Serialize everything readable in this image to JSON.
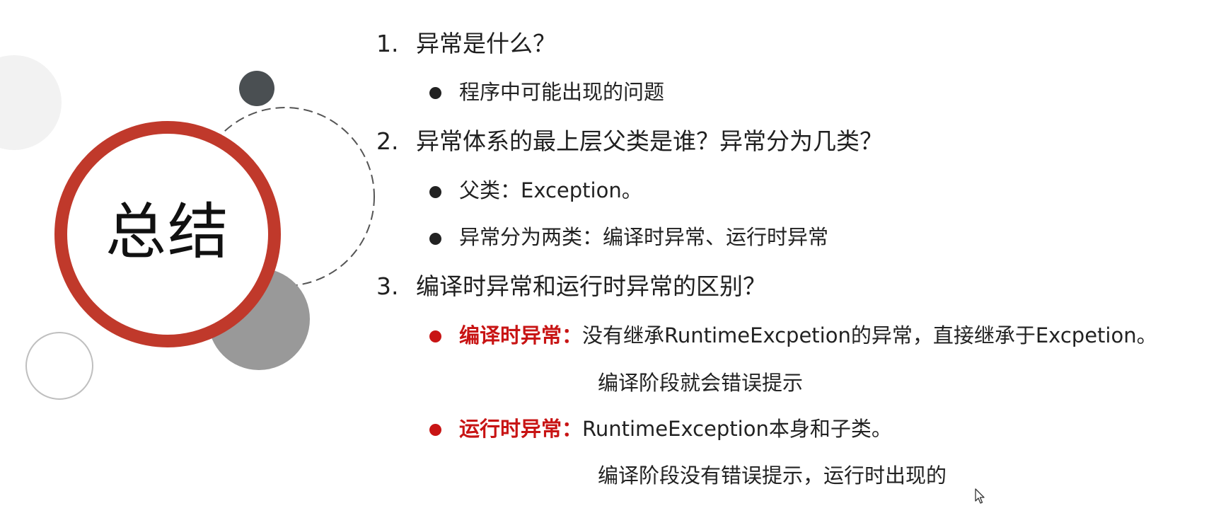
{
  "title": "总结",
  "sections": [
    {
      "number": "1.",
      "heading": "异常是什么？",
      "bullets": [
        {
          "text": "程序中可能出现的问题"
        }
      ]
    },
    {
      "number": "2.",
      "heading": "异常体系的最上层父类是谁？异常分为几类？",
      "bullets": [
        {
          "text": "父类：Exception。"
        },
        {
          "text": "异常分为两类：编译时异常、运行时异常"
        }
      ]
    },
    {
      "number": "3.",
      "heading": "编译时异常和运行时异常的区别？",
      "bullets": [
        {
          "label": "编译时异常：",
          "text": "没有继承RuntimeExcpetion的异常，直接继承于Excpetion。",
          "subtext": "编译阶段就会错误提示"
        },
        {
          "label": "运行时异常：",
          "text": "RuntimeException本身和子类。",
          "subtext": "编译阶段没有错误提示，运行时出现的"
        }
      ]
    }
  ],
  "colors": {
    "accent_red": "#c81414",
    "ring_red": "#c0392b",
    "dark_circle": "#4a4f52",
    "gray_circle": "#999999",
    "light_circle": "#f2f2f2"
  },
  "icons": {
    "cursor": "mouse-pointer-icon"
  }
}
